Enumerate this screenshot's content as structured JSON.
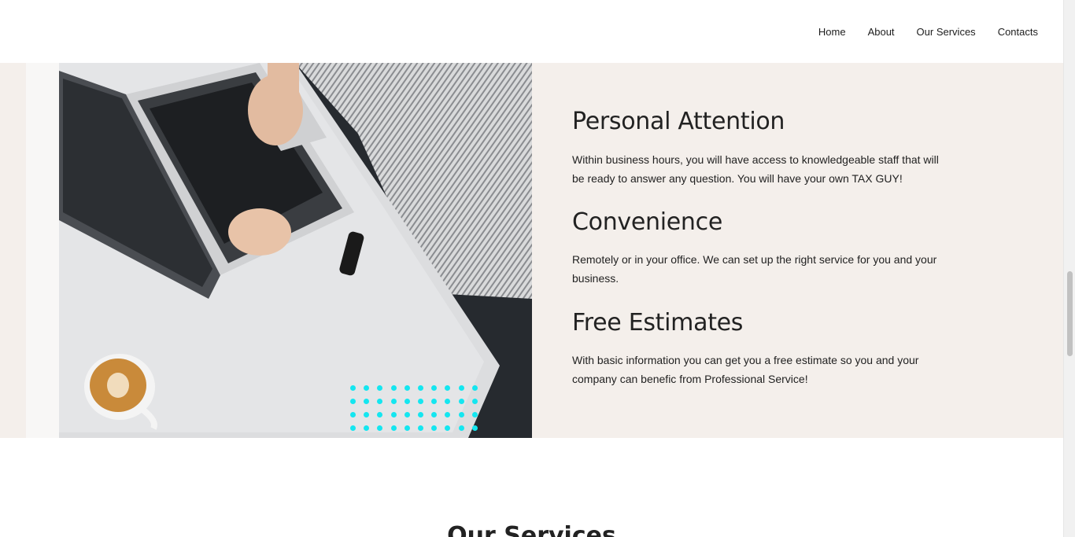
{
  "nav": {
    "items": [
      {
        "label": "Home"
      },
      {
        "label": "About"
      },
      {
        "label": "Our Services"
      },
      {
        "label": "Contacts"
      }
    ]
  },
  "features": [
    {
      "title": "Personal Attention",
      "text": "Within business hours, you will have access to knowledgeable staff that will be ready to answer any question. You will have your own TAX GUY!"
    },
    {
      "title": "Convenience",
      "text": "Remotely or in your office. We can set up the right service for you and your business."
    },
    {
      "title": "Free Estimates",
      "text": "With basic information you can get you a free estimate so you and your company can benefic from Professional Service!"
    }
  ],
  "services_heading": "Our Services",
  "colors": {
    "section_bg": "#f4efeb",
    "dot_accent": "#14e6f0",
    "text": "#222222"
  },
  "photo": {
    "icon": "laptop-photo"
  }
}
